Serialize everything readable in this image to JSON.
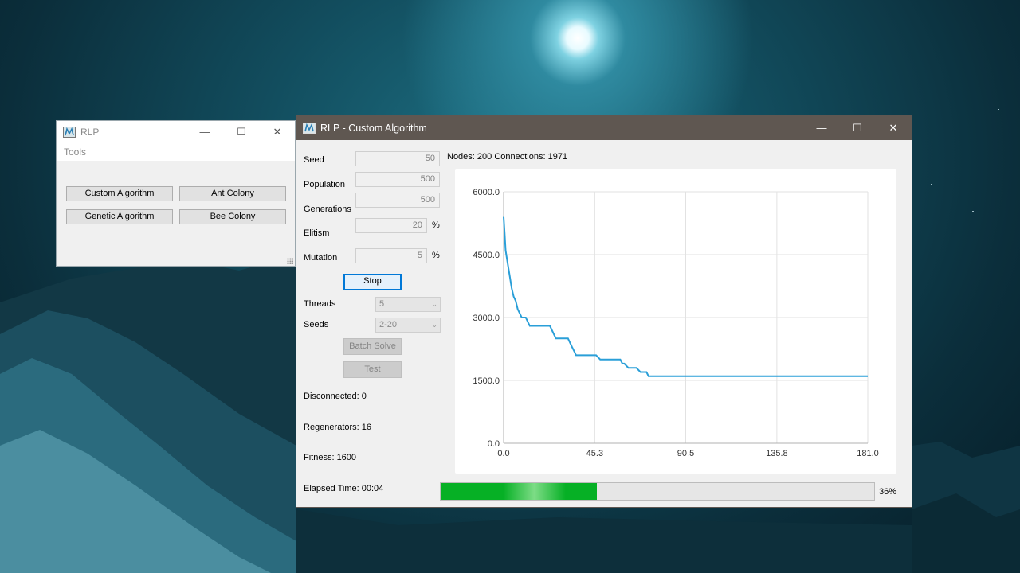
{
  "small_window": {
    "title": "RLP",
    "menu": [
      "Tools"
    ],
    "buttons": [
      "Custom Algorithm",
      "Ant Colony",
      "Genetic Algorithm",
      "Bee Colony"
    ],
    "controls": {
      "minimize": "—",
      "maximize": "☐",
      "close": "✕"
    }
  },
  "main_window": {
    "title": "RLP - Custom Algorithm",
    "controls": {
      "minimize": "—",
      "maximize": "☐",
      "close": "✕"
    },
    "form": {
      "seed": {
        "label": "Seed",
        "value": "50"
      },
      "population": {
        "label": "Population",
        "value": "500"
      },
      "generations": {
        "label": "Generations",
        "value": "500"
      },
      "elitism": {
        "label": "Elitism",
        "value": "20",
        "unit": "%"
      },
      "mutation": {
        "label": "Mutation",
        "value": "5",
        "unit": "%"
      },
      "stop_label": "Stop",
      "threads": {
        "label": "Threads",
        "value": "5"
      },
      "seeds": {
        "label": "Seeds",
        "value": "2-20"
      },
      "batch_solve_label": "Batch Solve",
      "test_label": "Test"
    },
    "stats": {
      "disconnected": "Disconnected: 0",
      "regenerators": "Regenerators: 16",
      "fitness": "Fitness: 1600",
      "elapsed": "Elapsed Time: 00:04"
    },
    "info": "Nodes: 200 Connections: 1971",
    "progress": {
      "value": 0.36,
      "label": "36%"
    }
  },
  "colors": {
    "line": "#2a9fd8",
    "progress": "#06b025",
    "titlebar": "#5f5751"
  },
  "chart_data": {
    "type": "line",
    "xlim": [
      0,
      181
    ],
    "ylim": [
      0,
      6000
    ],
    "x_ticks": [
      "0.0",
      "45.3",
      "90.5",
      "135.8",
      "181.0"
    ],
    "y_ticks": [
      "0.0",
      "1500.0",
      "3000.0",
      "4500.0",
      "6000.0"
    ],
    "grid": true,
    "series": [
      {
        "x": [
          0,
          0.5,
          1,
          2,
          3,
          4,
          5,
          6,
          7,
          8,
          9,
          10,
          11,
          12,
          13,
          15,
          17,
          20,
          22,
          23,
          24,
          25,
          26,
          27,
          29,
          32,
          33,
          34,
          35,
          36,
          37,
          38,
          40,
          42,
          46,
          48,
          50,
          52,
          56,
          58,
          59,
          60,
          62,
          64,
          66,
          68,
          70,
          71,
          72,
          73,
          74,
          76,
          80,
          100,
          130,
          160,
          181
        ],
        "y": [
          5400,
          5000,
          4600,
          4300,
          4000,
          3700,
          3500,
          3400,
          3200,
          3100,
          3000,
          3000,
          3000,
          2900,
          2800,
          2800,
          2800,
          2800,
          2800,
          2800,
          2700,
          2600,
          2500,
          2500,
          2500,
          2500,
          2400,
          2300,
          2200,
          2100,
          2100,
          2100,
          2100,
          2100,
          2100,
          2000,
          2000,
          2000,
          2000,
          2000,
          1900,
          1900,
          1800,
          1800,
          1800,
          1700,
          1700,
          1700,
          1600,
          1600,
          1600,
          1600,
          1600,
          1600,
          1600,
          1600,
          1600
        ]
      }
    ]
  }
}
